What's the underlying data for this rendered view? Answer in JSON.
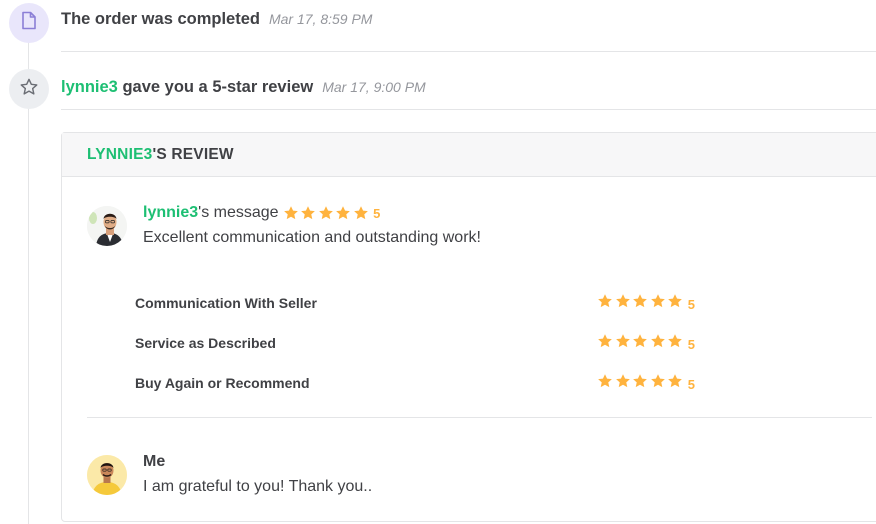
{
  "timeline": {
    "order_event": {
      "icon": "document-icon",
      "text": "The order was completed",
      "time": "Mar 17, 8:59 PM"
    },
    "review_event": {
      "icon": "star-outline-icon",
      "username": "lynnie3",
      "text": " gave you a 5-star review",
      "time": "Mar 17, 9:00 PM"
    }
  },
  "review": {
    "header_user": "LYNNIE3",
    "header_suffix": "'S REVIEW",
    "buyer": {
      "username": "lynnie3",
      "label_suffix": "'s message",
      "rating": 5,
      "rating_text": "5",
      "message": "Excellent communication and outstanding work!"
    },
    "criteria": [
      {
        "label": "Communication With Seller",
        "rating": 5,
        "rating_text": "5"
      },
      {
        "label": "Service as Described",
        "rating": 5,
        "rating_text": "5"
      },
      {
        "label": "Buy Again or Recommend",
        "rating": 5,
        "rating_text": "5"
      }
    ],
    "reply": {
      "name": "Me",
      "message": "I am grateful to you! Thank you.."
    }
  },
  "colors": {
    "accent": "#1dbf73",
    "star": "#ffb33e",
    "text": "#404145",
    "muted": "#95979d",
    "doc_icon_bg": "#e9e6fb",
    "doc_icon": "#8b7fd6"
  }
}
